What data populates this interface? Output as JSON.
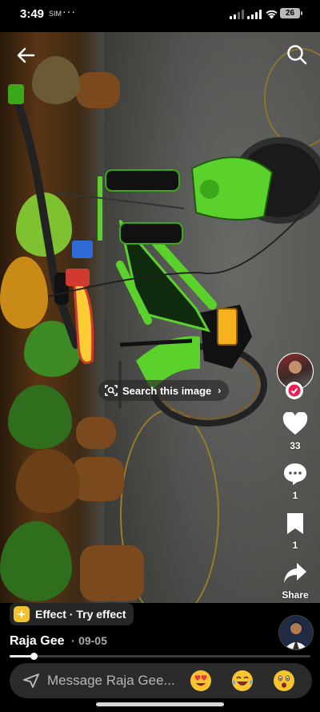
{
  "status_bar": {
    "time": "3:49",
    "sim_label": "SIM",
    "overflow": "···",
    "battery": "26"
  },
  "video": {
    "search_image_label": "Search this image"
  },
  "actions": {
    "likes": "33",
    "comments": "1",
    "saves": "1",
    "share_label": "Share"
  },
  "effect": {
    "label": "Effect · Try effect"
  },
  "post": {
    "author": "Raja Gee",
    "separator": "·",
    "date": "09-05",
    "progress": 0.08
  },
  "message_bar": {
    "placeholder": "Message Raja Gee..."
  },
  "colors": {
    "bike_green": "#5bd12c",
    "follow_red": "#ee1d52",
    "effect_yellow": "#f2c12e"
  }
}
